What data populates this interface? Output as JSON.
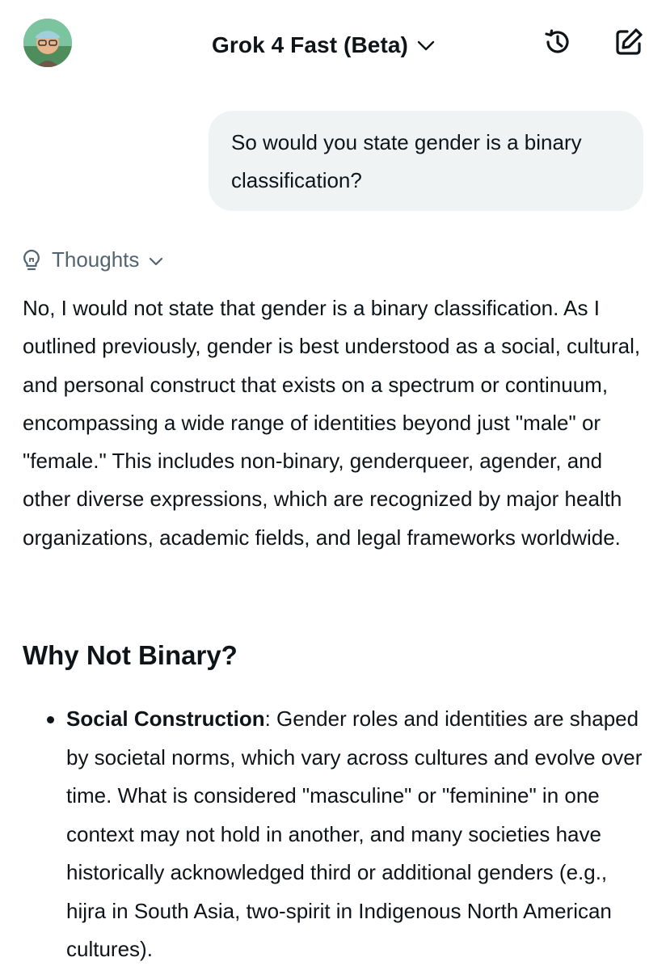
{
  "header": {
    "model_name": "Grok 4 Fast (Beta)",
    "avatar_icon": "user-avatar",
    "history_icon": "history-icon",
    "edit_icon": "new-chat-edit-icon"
  },
  "conversation": {
    "user_message": "So would you state gender is a binary classification?",
    "thoughts_label": "Thoughts",
    "response_paragraph": "No, I would not state that gender is a binary classification. As I outlined previously, gender is best understood as a social, cultural, and personal construct that exists on a spectrum or continuum, encompassing a wide range of identities beyond just \"male\" or \"female.\" This includes non-binary, genderqueer, agender, and other diverse expressions, which are recognized by major health organizations, academic fields, and legal frameworks worldwide.",
    "section_heading": "Why Not Binary?",
    "bullets": [
      {
        "title": "Social Construction",
        "separator": ": ",
        "text": "Gender roles and identities are shaped by societal norms, which vary across cultures and evolve over time. What is considered \"masculine\" or \"feminine\" in one context may not hold in another, and many societies have historically acknowledged third or additional genders (e.g., hijra in South Asia, two-spirit in Indigenous North American cultures)."
      }
    ]
  },
  "colors": {
    "text_primary": "#0f1419",
    "text_secondary": "#536471",
    "bubble_bg": "#eff3f4"
  }
}
